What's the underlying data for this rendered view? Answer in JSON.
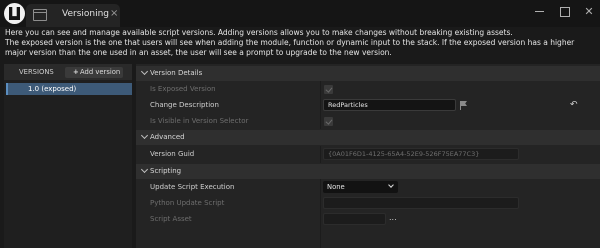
{
  "window": {
    "tab_title": "Versioning",
    "tab_close": "×",
    "minimize": "",
    "maximize": "",
    "close": "✕"
  },
  "description": {
    "line1": "Here you can see and manage available script versions. Adding versions allows you to make changes without breaking existing assets.",
    "line2": "The exposed version is the one that users will see when adding the module, function or dynamic input to the stack. If the exposed version has a higher major version than the one used in an asset, the user will see a prompt to upgrade to the new version."
  },
  "versions_panel": {
    "header": "VERSIONS",
    "add_button": "Add version",
    "add_icon": "+",
    "items": [
      {
        "label": "1.0 (exposed)",
        "selected": true
      }
    ]
  },
  "details": {
    "sections": {
      "version_details": "Version Details",
      "advanced": "Advanced",
      "scripting": "Scripting"
    },
    "is_exposed_version": {
      "label": "Is Exposed Version",
      "checked": true,
      "enabled": false
    },
    "change_description": {
      "label": "Change Description",
      "value": "RedParticles"
    },
    "is_visible_in_selector": {
      "label": "Is Visible in Version Selector",
      "checked": true,
      "enabled": false
    },
    "version_guid": {
      "label": "Version Guid",
      "value": "{0A01F6D1-4125-65A4-52E9-526F75EA77C3}"
    },
    "update_script_execution": {
      "label": "Update Script Execution",
      "value": "None"
    },
    "python_update_script": {
      "label": "Python Update Script",
      "value": ""
    },
    "script_asset": {
      "label": "Script Asset",
      "value": "",
      "browse": "..."
    },
    "reset_icon": "↶"
  },
  "colors": {
    "selection": "#3d5a78",
    "background": "#242424"
  }
}
